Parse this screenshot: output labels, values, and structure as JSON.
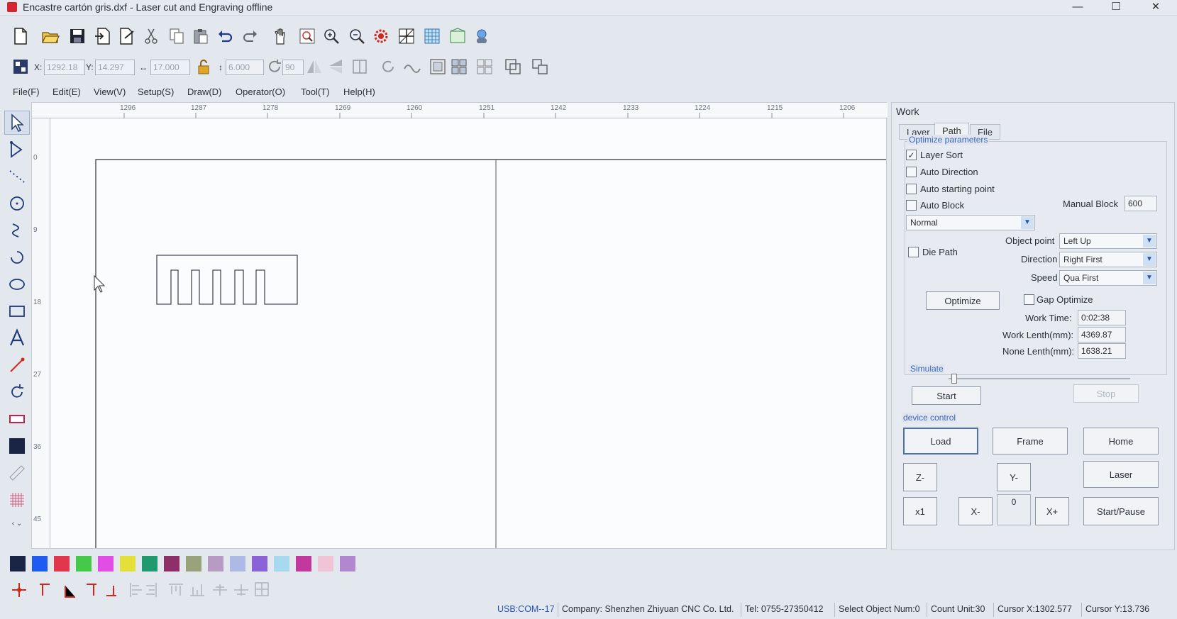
{
  "window": {
    "title": "Encastre cartón gris.dxf - Laser cut and Engraving offline",
    "controls": [
      "—",
      "☐",
      "✕"
    ]
  },
  "toolbar_top": {
    "icons": [
      "new-file",
      "open-folder",
      "save",
      "import",
      "export",
      "cut",
      "copy",
      "paste",
      "undo",
      "redo",
      "pan-hand",
      "zoom-page",
      "zoom-in",
      "zoom-out",
      "settings-gear",
      "grid-toggle",
      "array-grid",
      "frame-preview",
      "user-globe"
    ]
  },
  "toolbar_coords": {
    "x_label": "X:",
    "x_value": "1292.18",
    "y_label": "Y:",
    "y_value": "14.297",
    "w_value": "17.000",
    "h_value": "6.000",
    "rot_value": "90"
  },
  "menu": [
    "File(F)",
    "Edit(E)",
    "View(V)",
    "Setup(S)",
    "Draw(D)",
    "Operator(O)",
    "Tool(T)",
    "Help(H)"
  ],
  "ruler": {
    "top": [
      "1296",
      "1287",
      "1278",
      "1269",
      "1260",
      "1251",
      "1242",
      "1233",
      "1224",
      "1215",
      "1206"
    ],
    "left": [
      "0",
      "9",
      "18",
      "27",
      "36",
      "45"
    ]
  },
  "palette": {
    "colors": [
      "#1a2444",
      "#1f5bf2",
      "#e2364f",
      "#45c94a",
      "#e24de5",
      "#e5df3a",
      "#1f9a6e",
      "#8f2f6a",
      "#9aa27b",
      "#b79bc4",
      "#aeb9e6",
      "#8c62d9",
      "#a7d9ef",
      "#c2389e",
      "#f0c4d6",
      "#b287cf"
    ]
  },
  "work_panel": {
    "title": "Work",
    "tabs": [
      "Layer",
      "Path",
      "File"
    ],
    "active_tab": "Path",
    "optimize_group": "Optimize parameters",
    "layer_sort": "Layer Sort",
    "auto_direction": "Auto Direction",
    "auto_starting_point": "Auto starting point",
    "auto_block": "Auto Block",
    "manual_block_label": "Manual Block",
    "manual_block_value": "600",
    "mode_select": "Normal",
    "die_path": "Die Path",
    "object_point_label": "Object point",
    "object_point_value": "Left Up",
    "direction_label": "Direction",
    "direction_value": "Right First",
    "speed_label": "Speed",
    "speed_value": "Qua First",
    "optimize_button": "Optimize",
    "gap_optimize": "Gap Optimize",
    "work_time_label": "Work Time:",
    "work_time_value": "0:02:38",
    "work_length_label": "Work Lenth(mm):",
    "work_length_value": "4369.87",
    "none_length_label": "None Lenth(mm):",
    "none_length_value": "1638.21",
    "simulate_group": "Simulate",
    "simulate_progress": 0.03,
    "start_button": "Start",
    "stop_button": "Stop",
    "device_group": "device control",
    "load_button": "Load",
    "frame_button": "Frame",
    "home_button": "Home",
    "zminus_button": "Z-",
    "yminus_button": "Y-",
    "laser_button": "Laser",
    "x1_button": "x1",
    "xminus_button": "X-",
    "step_value": "0",
    "xplus_button": "X+",
    "startpause_button": "Start/Pause"
  },
  "status": {
    "port": "USB:COM--17",
    "company": "Company: Shenzhen Zhiyuan CNC Co. Ltd.",
    "tel": "Tel: 0755-27350412",
    "select": "Select Object Num:0",
    "count": "Count Unit:30",
    "cursor_x": "Cursor X:1302.577",
    "cursor_y": "Cursor Y:13.736"
  }
}
